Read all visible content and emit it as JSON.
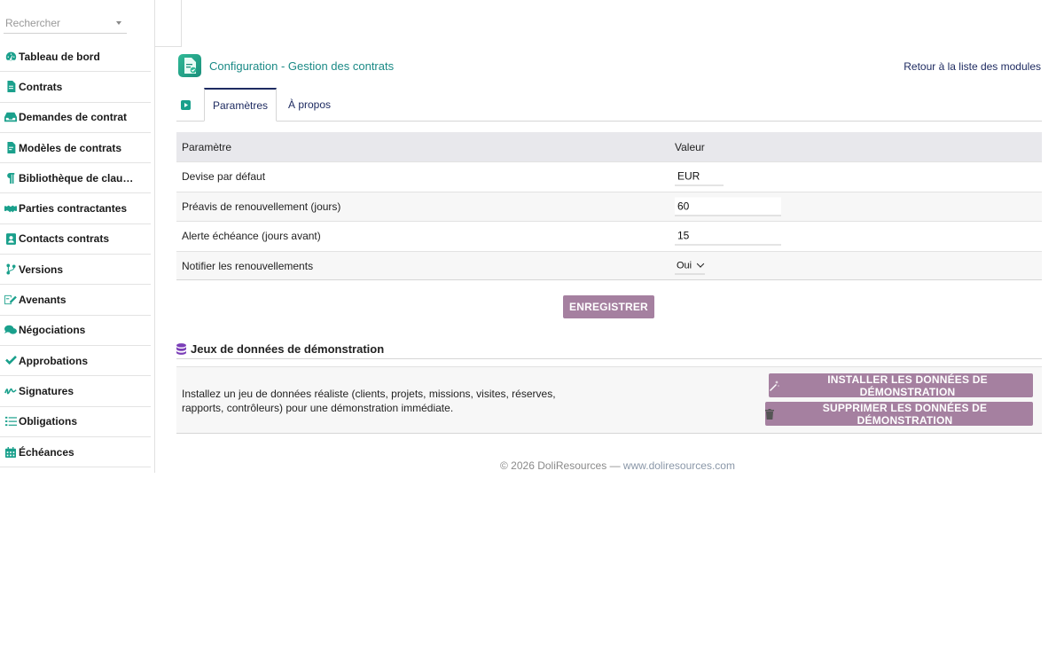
{
  "search": {
    "placeholder": "Rechercher"
  },
  "menu": {
    "items": [
      {
        "label": "Tableau de bord",
        "icon": "dashboard-icon"
      },
      {
        "label": "Contrats",
        "icon": "file-icon"
      },
      {
        "label": "Demandes de contrat",
        "icon": "inbox-icon"
      },
      {
        "label": "Modèles de contrats",
        "icon": "file-template-icon"
      },
      {
        "label": "Bibliothèque de clau…",
        "icon": "paragraph-icon"
      },
      {
        "label": "Parties contractantes",
        "icon": "handshake-icon"
      },
      {
        "label": "Contacts contrats",
        "icon": "contact-card-icon"
      },
      {
        "label": "Versions",
        "icon": "branch-icon"
      },
      {
        "label": "Avenants",
        "icon": "edit-file-icon"
      },
      {
        "label": "Négociations",
        "icon": "comments-icon"
      },
      {
        "label": "Approbations",
        "icon": "double-check-icon"
      },
      {
        "label": "Signatures",
        "icon": "signature-icon"
      },
      {
        "label": "Obligations",
        "icon": "list-check-icon"
      },
      {
        "label": "Échéances",
        "icon": "calendar-icon"
      }
    ]
  },
  "header": {
    "title": "Configuration - Gestion des contrats",
    "back_link": "Retour à la liste des modules"
  },
  "tabs": [
    {
      "label": "Paramètres",
      "active": true
    },
    {
      "label": "À propos",
      "active": false
    }
  ],
  "params": {
    "col_param": "Paramètre",
    "col_value": "Valeur",
    "rows": [
      {
        "label": "Devise par défaut",
        "value": "EUR"
      },
      {
        "label": "Préavis de renouvellement (jours)",
        "value": "60"
      },
      {
        "label": "Alerte échéance (jours avant)",
        "value": "15"
      },
      {
        "label": "Notifier les renouvellements",
        "value": "Oui"
      }
    ]
  },
  "save_button": "ENREGISTRER",
  "demo": {
    "title": "Jeux de données de démonstration",
    "description": "Installez un jeu de données réaliste (clients, projets, missions, visites, réserves, rapports, contrôleurs) pour une démonstration immédiate.",
    "install_button": "INSTALLER LES DONNÉES DE DÉMONSTRATION",
    "delete_button": "SUPPRIMER LES DONNÉES DE DÉMONSTRATION"
  },
  "footer": {
    "copyright": "© 2026 DoliResources — ",
    "link": "www.doliresources.com"
  },
  "colors": {
    "accent_teal": "#1b8a86",
    "menu_icon": "#1aa08c",
    "button_purple": "#a580a0",
    "link_navy": "#1e2b61",
    "demo_icon_purple": "#7b3fb8"
  }
}
